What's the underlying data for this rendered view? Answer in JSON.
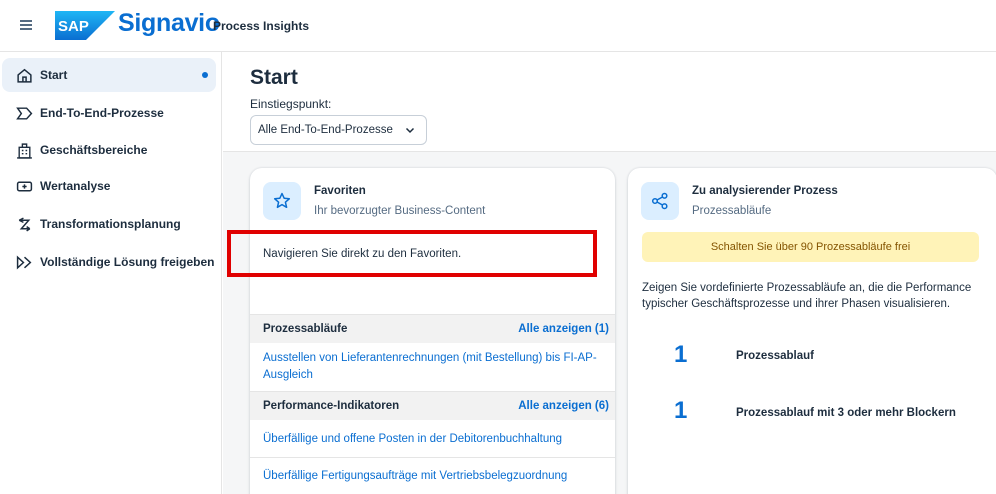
{
  "shell": {
    "brand_logo": "SAP",
    "product_name": "Signavio",
    "app_title": "Process Insights",
    "menu_icon": "hamburger-menu-icon",
    "accent_color": "#0a6ed1"
  },
  "sidebar": {
    "items": [
      {
        "label": "Start",
        "icon": "home-icon",
        "active": true,
        "indicator": true
      },
      {
        "label": "End-To-End-Prozesse",
        "icon": "process-chevron-icon",
        "active": false
      },
      {
        "label": "Geschäftsbereiche",
        "icon": "building-icon",
        "active": false
      },
      {
        "label": "Wertanalyse",
        "icon": "value-analysis-icon",
        "active": false
      },
      {
        "label": "Transformationsplanung",
        "icon": "transform-arrows-icon",
        "active": false
      },
      {
        "label": "Vollständige Lösung freigeben",
        "icon": "unlock-chevron-icon",
        "active": false
      }
    ]
  },
  "header": {
    "title": "Start",
    "entry_label": "Einstiegspunkt:",
    "entry_value": "Alle End-To-End-Prozesse"
  },
  "favorites_card": {
    "icon": "star-icon",
    "title": "Favoriten",
    "subtitle": "Ihr bevorzugter Business-Content",
    "text": "Navigieren Sie direkt zu den Favoriten.",
    "groups": [
      {
        "title": "Prozessabläufe",
        "link": "Alle anzeigen (1)",
        "items": [
          "Ausstellen von Lieferantenrechnungen (mit Bestellung) bis FI-AP-Ausgleich"
        ]
      },
      {
        "title": "Performance-Indikatoren",
        "link": "Alle anzeigen (6)",
        "items": [
          "Überfällige und offene Posten in der Debitorenbuchhaltung",
          "Überfällige Fertigungsaufträge mit Vertriebsbelegzuordnung"
        ]
      }
    ],
    "highlight_color": "#e00000"
  },
  "process_card": {
    "icon": "share-icon",
    "title": "Zu analysierender Prozess",
    "subtitle": "Prozessabläufe",
    "banner": "Schalten Sie über 90 Prozessabläufe frei",
    "banner_color": "#fff3b8",
    "description": "Zeigen Sie vordefinierte Prozessabläufe an, die die Performance typischer Geschäftsprozesse und ihrer Phasen visualisieren.",
    "kpis": [
      {
        "value": "1",
        "label": "Prozessablauf"
      },
      {
        "value": "1",
        "label": "Prozessablauf mit 3 oder mehr Blockern"
      }
    ]
  }
}
